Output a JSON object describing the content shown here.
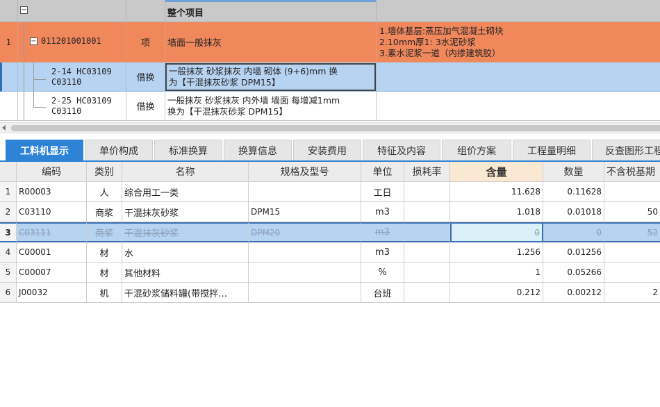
{
  "top_grid": {
    "header": {
      "name": "整个项目"
    },
    "rows": [
      {
        "num": "1",
        "code": "011201001001",
        "type": "项",
        "name": "墙面一般抹灰",
        "features": [
          "1.墙体基层:蒸压加气混凝土砌块",
          "2.10mm厚1: 3水泥砂浆",
          "3.素水泥浆一道（内掺建筑胶）"
        ]
      },
      {
        "num": "",
        "code_lines": [
          "2-14 HC03109",
          "C03110"
        ],
        "type": "借换",
        "name_lines": [
          "一般抹灰 砂浆抹灰 内墙 砌体 (9+6)mm  换",
          "为【干混抹灰砂浆 DPM15】"
        ]
      },
      {
        "num": "",
        "code_lines": [
          "2-25 HC03109",
          "C03110"
        ],
        "type": "借换",
        "name_lines": [
          "一般抹灰 砂浆抹灰 内外墙 墙面 每增减1mm",
          " 换为【干混抹灰砂浆 DPM15】"
        ]
      }
    ]
  },
  "tabs": [
    {
      "label": "工料机显示",
      "active": true
    },
    {
      "label": "单价构成"
    },
    {
      "label": "标准换算"
    },
    {
      "label": "换算信息"
    },
    {
      "label": "安装费用"
    },
    {
      "label": "特征及内容"
    },
    {
      "label": "组价方案"
    },
    {
      "label": "工程量明细"
    },
    {
      "label": "反查图形工程量"
    }
  ],
  "bottom_grid": {
    "columns": {
      "code": "编码",
      "type": "类别",
      "name": "名称",
      "spec": "规格及型号",
      "unit": "单位",
      "loss": "损耗率",
      "qty": "含量",
      "num": "数量",
      "notax": "不含税基期"
    },
    "rows": [
      {
        "idx": "1",
        "code": "R00003",
        "type": "人",
        "name": "综合用工一类",
        "spec": "",
        "unit": "工日",
        "loss": "",
        "qty": "11.628",
        "num": "0.11628",
        "notax": ""
      },
      {
        "idx": "2",
        "code": "C03110",
        "type": "商浆",
        "name": "干混抹灰砂浆",
        "spec": "DPM15",
        "unit": "m3",
        "loss": "",
        "qty": "1.018",
        "num": "0.01018",
        "notax": "50"
      },
      {
        "idx": "3",
        "code": "C03111",
        "type": "商浆",
        "name": "干混抹灰砂浆",
        "spec": "DPM20",
        "unit": "m3",
        "loss": "",
        "qty": "0",
        "num": "0",
        "notax": "52"
      },
      {
        "idx": "4",
        "code": "C00001",
        "type": "材",
        "name": "水",
        "spec": "",
        "unit": "m3",
        "loss": "",
        "qty": "1.256",
        "num": "0.01256",
        "notax": ""
      },
      {
        "idx": "5",
        "code": "C00007",
        "type": "材",
        "name": "其他材料",
        "spec": "",
        "unit": "%",
        "loss": "",
        "qty": "1",
        "num": "0.05266",
        "notax": ""
      },
      {
        "idx": "6",
        "code": "J00032",
        "type": "机",
        "name": "干混砂浆储料罐(带搅拌…",
        "spec": "",
        "unit": "台班",
        "loss": "",
        "qty": "0.212",
        "num": "0.00212",
        "notax": "2"
      }
    ]
  },
  "colors": {
    "item_row": "#f0885c",
    "selected_row": "#b7d3f2",
    "active_tab": "#2f83d6",
    "highlight_header": "#fbe8d2"
  }
}
